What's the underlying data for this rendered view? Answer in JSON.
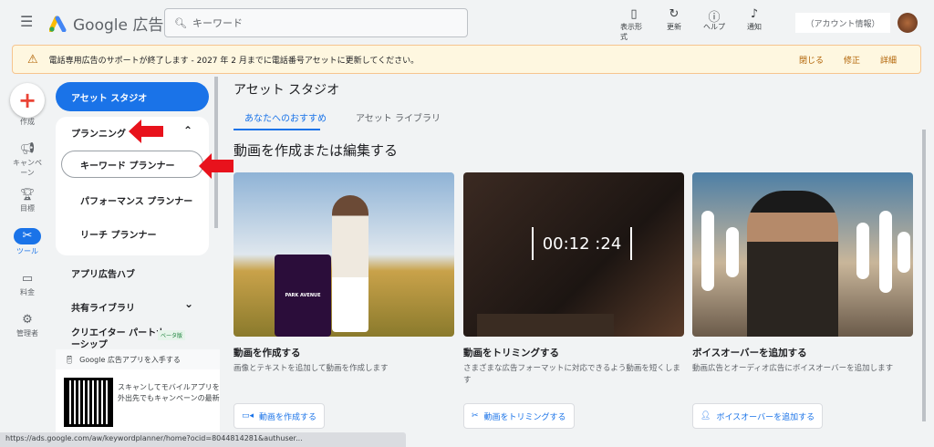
{
  "header": {
    "product": "Google 広告",
    "search_placeholder": "キーワード",
    "tools": [
      {
        "label": "表示形式",
        "icon": "view-icon"
      },
      {
        "label": "更新",
        "icon": "refresh-icon"
      },
      {
        "label": "ヘルプ",
        "icon": "help-icon"
      },
      {
        "label": "通知",
        "icon": "bell-icon"
      }
    ],
    "account": "（アカウント情報）"
  },
  "banner": {
    "text": "電話専用広告のサポートが終了します - 2027 年 2 月までに電話番号アセットに更新してください。",
    "actions": [
      "閉じる",
      "修正",
      "詳細"
    ]
  },
  "rail": {
    "items": [
      "作成",
      "キャンペーン",
      "目標",
      "ツール",
      "料金",
      "管理者"
    ],
    "active": "ツール"
  },
  "nav": {
    "studio": "アセット スタジオ",
    "planning": "プランニング",
    "planning_items": [
      "キーワード プランナー",
      "パフォーマンス プランナー",
      "リーチ プランナー"
    ],
    "app_hub": "アプリ広告ハブ",
    "shared_library": "共有ライブラリ",
    "creator": "クリエイター パートナーシップ",
    "beta": "ベータ版"
  },
  "app_promo": {
    "title": "Google 広告アプリを入手する",
    "text1": "スキャンしてモバイルアプリを",
    "text2": "外出先でもキャンペーンの最新"
  },
  "status_url": "https://ads.google.com/aw/keywordplanner/home?ocid=8044814281&authuser...",
  "main": {
    "title": "アセット スタジオ",
    "tabs": [
      "あなたへのおすすめ",
      "アセット ライブラリ"
    ],
    "section": "動画を作成または編集する",
    "cards": [
      {
        "title": "動画を作成する",
        "desc": "画像とテキストを追加して動画を作成します",
        "button": "動画を作成する",
        "overlay": "PARK AVENUE"
      },
      {
        "title": "動画をトリミングする",
        "desc": "さまざまな広告フォーマットに対応できるよう動画を短くします",
        "button": "動画をトリミングする",
        "overlay": "00:12 :24"
      },
      {
        "title": "ボイスオーバーを追加する",
        "desc": "動画広告とオーディオ広告にボイスオーバーを追加します",
        "button": "ボイスオーバーを追加する"
      }
    ]
  },
  "colors": {
    "accent": "#1a73e8",
    "warning": "#b06000",
    "arrow": "#e8121c"
  }
}
